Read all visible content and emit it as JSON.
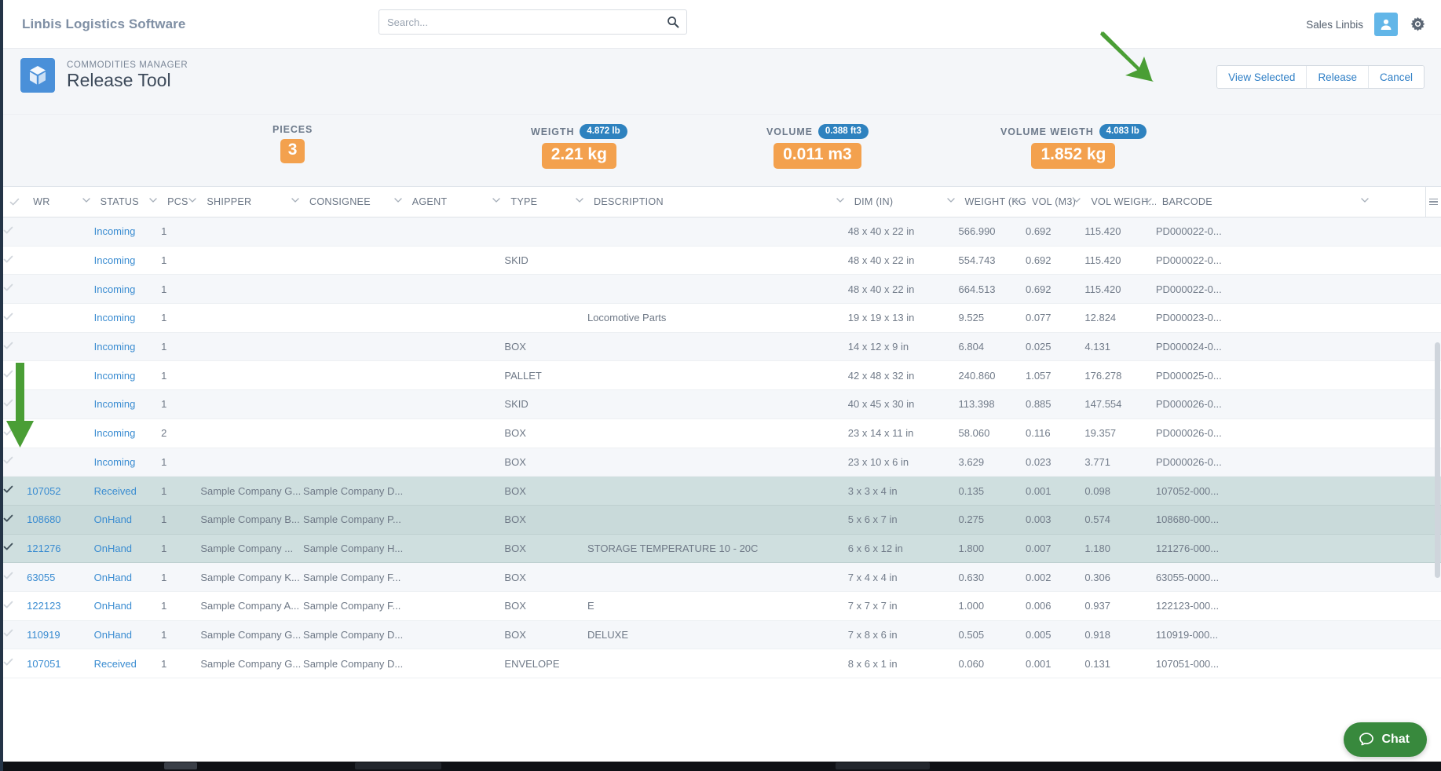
{
  "topbar": {
    "brand": "Linbis Logistics Software",
    "search_placeholder": "Search...",
    "search_value": "",
    "username": "Sales Linbis"
  },
  "page_header": {
    "kicker": "COMMODITIES MANAGER",
    "title": "Release Tool",
    "actions": [
      {
        "label": "View Selected"
      },
      {
        "label": "Release"
      },
      {
        "label": "Cancel"
      }
    ]
  },
  "stats": [
    {
      "label": "PIECES",
      "badge": "",
      "value": "3"
    },
    {
      "label": "WEIGTH",
      "badge": "4.872 lb",
      "value": "2.21 kg"
    },
    {
      "label": "VOLUME",
      "badge": "0.388 ft3",
      "value": "0.011 m3"
    },
    {
      "label": "VOLUME WEIGTH",
      "badge": "4.083 lb",
      "value": "1.852 kg"
    }
  ],
  "table": {
    "columns": [
      "WR",
      "STATUS",
      "PCS",
      "SHIPPER",
      "CONSIGNEE",
      "AGENT",
      "TYPE",
      "DESCRIPTION",
      "DIM (IN)",
      "WEIGHT (KG)",
      "VOL (M3)",
      "VOL WEIGH...",
      "BARCODE"
    ],
    "rows": [
      {
        "selected": false,
        "dim_checked": true,
        "wr": "",
        "status": "Incoming",
        "pcs": "1",
        "shipper": "",
        "consignee": "",
        "agent": "",
        "type": "",
        "description": "",
        "dim": "48 x 40 x 22 in",
        "weight": "566.990",
        "vol": "0.692",
        "volweight": "115.420",
        "barcode": "PD000022-0..."
      },
      {
        "selected": false,
        "dim_checked": true,
        "wr": "",
        "status": "Incoming",
        "pcs": "1",
        "shipper": "",
        "consignee": "",
        "agent": "",
        "type": "SKID",
        "description": "",
        "dim": "48 x 40 x 22 in",
        "weight": "554.743",
        "vol": "0.692",
        "volweight": "115.420",
        "barcode": "PD000022-0..."
      },
      {
        "selected": false,
        "dim_checked": true,
        "wr": "",
        "status": "Incoming",
        "pcs": "1",
        "shipper": "",
        "consignee": "",
        "agent": "",
        "type": "",
        "description": "",
        "dim": "48 x 40 x 22 in",
        "weight": "664.513",
        "vol": "0.692",
        "volweight": "115.420",
        "barcode": "PD000022-0..."
      },
      {
        "selected": false,
        "dim_checked": true,
        "wr": "",
        "status": "Incoming",
        "pcs": "1",
        "shipper": "",
        "consignee": "",
        "agent": "",
        "type": "",
        "description": "Locomotive Parts",
        "dim": "19 x 19 x 13 in",
        "weight": "9.525",
        "vol": "0.077",
        "volweight": "12.824",
        "barcode": "PD000023-0..."
      },
      {
        "selected": false,
        "dim_checked": true,
        "wr": "",
        "status": "Incoming",
        "pcs": "1",
        "shipper": "",
        "consignee": "",
        "agent": "",
        "type": "BOX",
        "description": "",
        "dim": "14 x 12 x 9 in",
        "weight": "6.804",
        "vol": "0.025",
        "volweight": "4.131",
        "barcode": "PD000024-0..."
      },
      {
        "selected": false,
        "dim_checked": true,
        "wr": "",
        "status": "Incoming",
        "pcs": "1",
        "shipper": "",
        "consignee": "",
        "agent": "",
        "type": "PALLET",
        "description": "",
        "dim": "42 x 48 x 32 in",
        "weight": "240.860",
        "vol": "1.057",
        "volweight": "176.278",
        "barcode": "PD000025-0..."
      },
      {
        "selected": false,
        "dim_checked": true,
        "wr": "",
        "status": "Incoming",
        "pcs": "1",
        "shipper": "",
        "consignee": "",
        "agent": "",
        "type": "SKID",
        "description": "",
        "dim": "40 x 45 x 30 in",
        "weight": "113.398",
        "vol": "0.885",
        "volweight": "147.554",
        "barcode": "PD000026-0..."
      },
      {
        "selected": false,
        "dim_checked": true,
        "wr": "",
        "status": "Incoming",
        "pcs": "2",
        "shipper": "",
        "consignee": "",
        "agent": "",
        "type": "BOX",
        "description": "",
        "dim": "23 x 14 x 11 in",
        "weight": "58.060",
        "vol": "0.116",
        "volweight": "19.357",
        "barcode": "PD000026-0..."
      },
      {
        "selected": false,
        "dim_checked": true,
        "wr": "",
        "status": "Incoming",
        "pcs": "1",
        "shipper": "",
        "consignee": "",
        "agent": "",
        "type": "BOX",
        "description": "",
        "dim": "23 x 10 x 6 in",
        "weight": "3.629",
        "vol": "0.023",
        "volweight": "3.771",
        "barcode": "PD000026-0..."
      },
      {
        "selected": true,
        "dim_checked": false,
        "wr": "107052",
        "status": "Received",
        "pcs": "1",
        "shipper": "Sample Company G...",
        "consignee": "Sample Company D...",
        "agent": "",
        "type": "BOX",
        "description": "",
        "dim": "3 x 3 x 4 in",
        "weight": "0.135",
        "vol": "0.001",
        "volweight": "0.098",
        "barcode": "107052-000..."
      },
      {
        "selected": true,
        "dim_checked": false,
        "wr": "108680",
        "status": "OnHand",
        "pcs": "1",
        "shipper": "Sample Company B...",
        "consignee": "Sample Company P...",
        "agent": "",
        "type": "BOX",
        "description": "",
        "dim": "5 x 6 x 7 in",
        "weight": "0.275",
        "vol": "0.003",
        "volweight": "0.574",
        "barcode": "108680-000..."
      },
      {
        "selected": true,
        "dim_checked": false,
        "wr": "121276",
        "status": "OnHand",
        "pcs": "1",
        "shipper": "Sample Company ...",
        "consignee": "Sample Company H...",
        "agent": "",
        "type": "BOX",
        "description": "STORAGE TEMPERATURE 10 - 20C",
        "dim": "6 x 6 x 12 in",
        "weight": "1.800",
        "vol": "0.007",
        "volweight": "1.180",
        "barcode": "121276-000..."
      },
      {
        "selected": false,
        "dim_checked": true,
        "wr": "63055",
        "status": "OnHand",
        "pcs": "1",
        "shipper": "Sample Company K...",
        "consignee": "Sample Company F...",
        "agent": "",
        "type": "BOX",
        "description": "",
        "dim": "7 x 4 x 4 in",
        "weight": "0.630",
        "vol": "0.002",
        "volweight": "0.306",
        "barcode": "63055-0000..."
      },
      {
        "selected": false,
        "dim_checked": true,
        "wr": "122123",
        "status": "OnHand",
        "pcs": "1",
        "shipper": "Sample Company A...",
        "consignee": "Sample Company F...",
        "agent": "",
        "type": "BOX",
        "description": "E",
        "dim": "7 x 7 x 7 in",
        "weight": "1.000",
        "vol": "0.006",
        "volweight": "0.937",
        "barcode": "122123-000..."
      },
      {
        "selected": false,
        "dim_checked": true,
        "wr": "110919",
        "status": "OnHand",
        "pcs": "1",
        "shipper": "Sample Company G...",
        "consignee": "Sample Company D...",
        "agent": "",
        "type": "BOX",
        "description": "DELUXE",
        "dim": "7 x 8 x 6 in",
        "weight": "0.505",
        "vol": "0.005",
        "volweight": "0.918",
        "barcode": "110919-000..."
      },
      {
        "selected": false,
        "dim_checked": true,
        "wr": "107051",
        "status": "Received",
        "pcs": "1",
        "shipper": "Sample Company G...",
        "consignee": "Sample Company D...",
        "agent": "",
        "type": "ENVELOPE",
        "description": "",
        "dim": "8 x 6 x 1 in",
        "weight": "0.060",
        "vol": "0.001",
        "volweight": "0.131",
        "barcode": "107051-000..."
      }
    ]
  },
  "chat": {
    "label": "Chat"
  },
  "colors": {
    "accent_blue": "#4a90d9",
    "link_blue": "#3a8cd1",
    "badge_blue": "#2e82bf",
    "value_orange": "#f3a14e",
    "selected_row": "#cfdfdf",
    "arrow_green": "#4a9e35",
    "chat_green": "#38893d"
  }
}
